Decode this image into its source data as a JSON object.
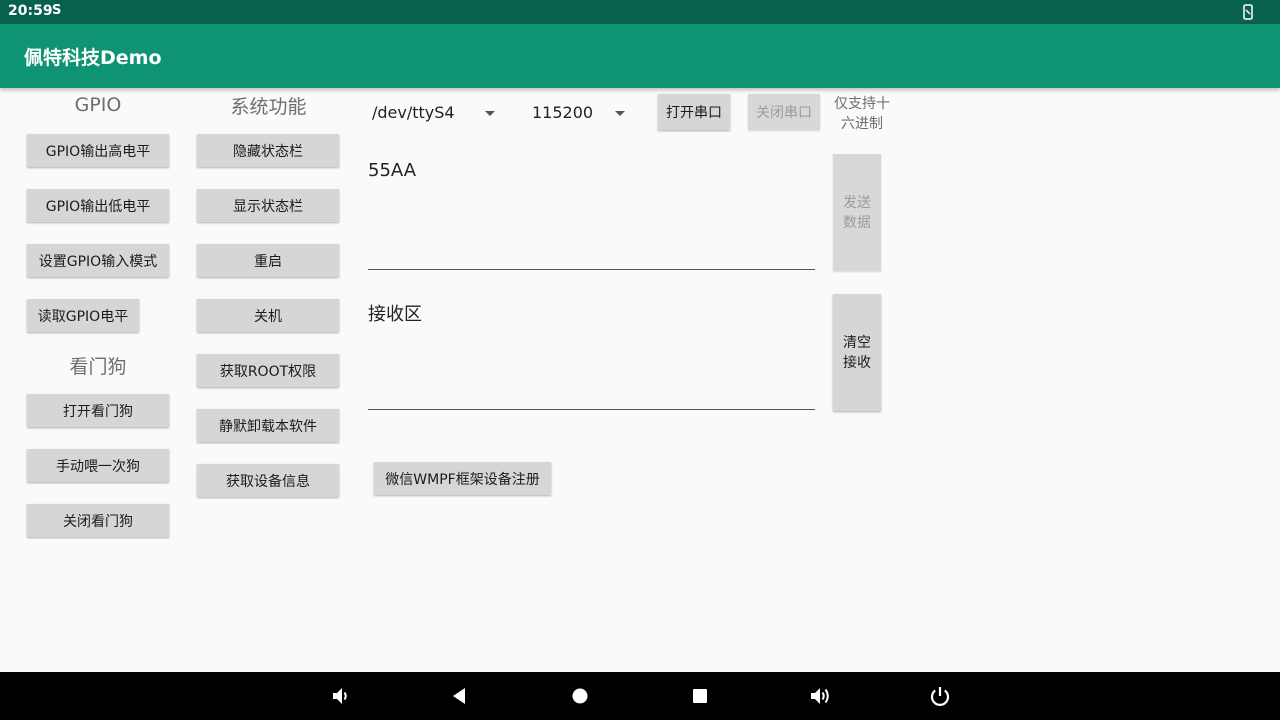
{
  "status_bar": {
    "time": "20:59",
    "indicator": "S"
  },
  "app_bar": {
    "title": "佩特科技Demo"
  },
  "gpio": {
    "heading": "GPIO",
    "buttons": [
      "GPIO输出高电平",
      "GPIO输出低电平",
      "设置GPIO输入模式",
      "读取GPIO电平"
    ]
  },
  "watchdog": {
    "heading": "看门狗",
    "buttons": [
      "打开看门狗",
      "手动喂一次狗",
      "关闭看门狗"
    ]
  },
  "system": {
    "heading": "系统功能",
    "buttons": [
      "隐藏状态栏",
      "显示状态栏",
      "重启",
      "关机",
      "获取ROOT权限",
      "静默卸载本软件",
      "获取设备信息"
    ]
  },
  "serial": {
    "port": "/dev/ttyS4",
    "baud": "115200",
    "open_label": "打开串口",
    "close_label": "关闭串口",
    "hint_line1": "仅支持十",
    "hint_line2": "六进制",
    "send_value": "55AA",
    "send_label_1": "发送",
    "send_label_2": "数据",
    "receive_placeholder": "接收区",
    "clear_label_1": "清空",
    "clear_label_2": "接收",
    "wmpf_label": "微信WMPF框架设备注册"
  },
  "nav_bar": {
    "icons": [
      "volume-down-icon",
      "back-icon",
      "home-icon",
      "recents-icon",
      "volume-up-icon",
      "power-icon"
    ]
  }
}
